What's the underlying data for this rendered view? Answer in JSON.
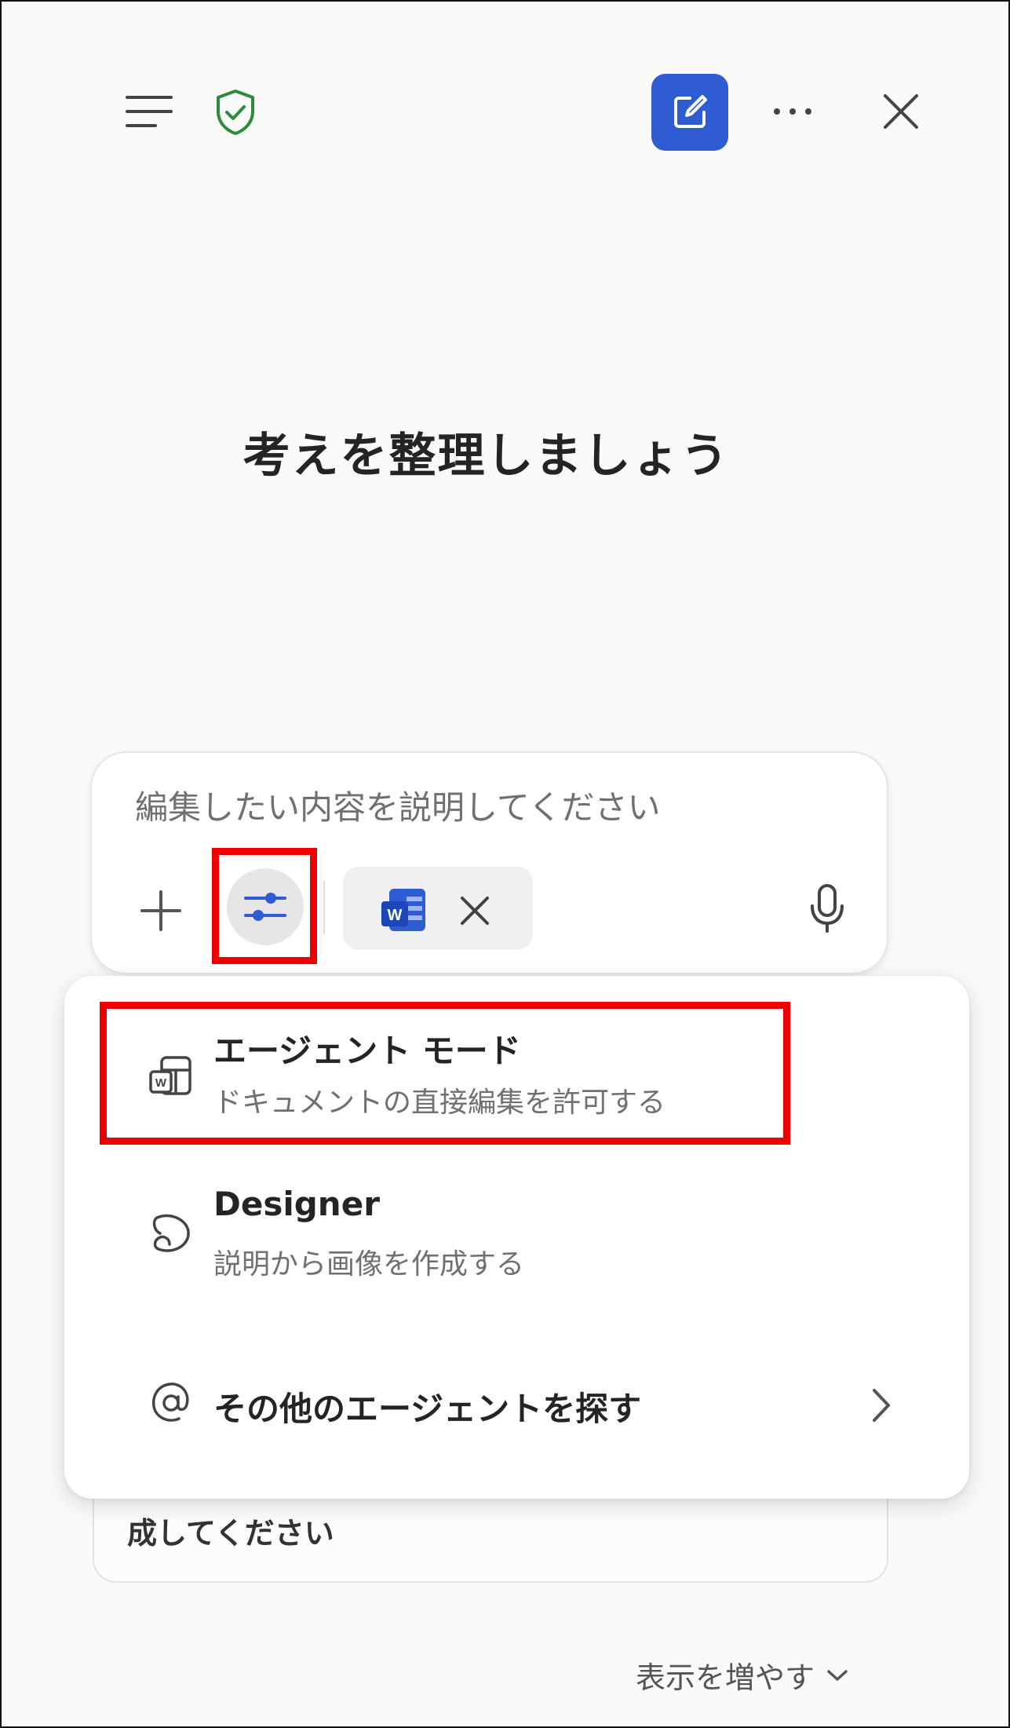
{
  "header": {
    "menu_icon": "menu-icon",
    "shield_icon": "shield-check-icon",
    "new_chat_icon": "compose-icon",
    "more_icon": "more-horizontal-icon",
    "close_icon": "close-icon",
    "accent_color": "#2f5bd3",
    "shield_color": "#2e8b3a"
  },
  "main": {
    "title": "考えを整理しましょう"
  },
  "composer": {
    "placeholder": "編集したい内容を説明してください",
    "attachment_icon": "word-document-icon"
  },
  "menu": {
    "items": [
      {
        "title": "エージェント モード",
        "subtitle": "ドキュメントの直接編集を許可する",
        "icon": "word-agent-icon"
      },
      {
        "title": "Designer",
        "subtitle": "説明から画像を作成する",
        "icon": "designer-icon"
      },
      {
        "title": "その他のエージェントを探す",
        "icon": "at-icon"
      }
    ]
  },
  "background_card": {
    "text": "成してください"
  },
  "footer": {
    "show_more": "表示を増やす"
  },
  "highlight_color": "#ee0000"
}
